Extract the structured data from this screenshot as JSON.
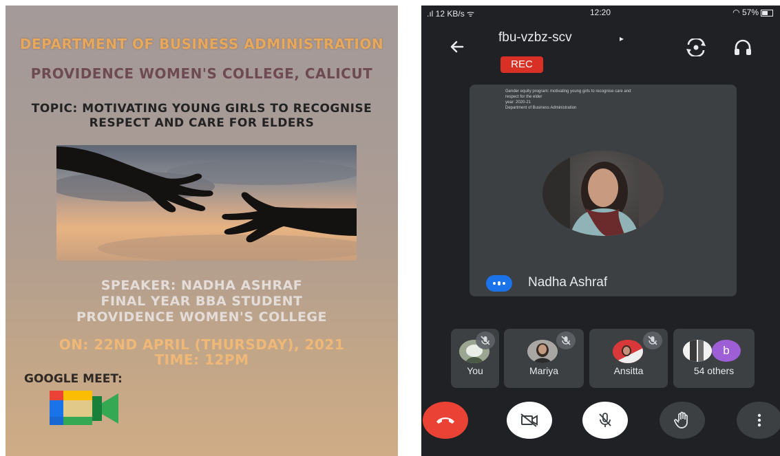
{
  "poster": {
    "department": "DEPARTMENT OF BUSINESS ADMINISTRATION",
    "college": "PROVIDENCE WOMEN'S COLLEGE, CALICUT",
    "topic_line1": "TOPIC: MOTIVATING YOUNG GIRLS TO RECOGNISE",
    "topic_line2": "RESPECT AND CARE FOR ELDERS",
    "speaker_line1": "SPEAKER: NADHA ASHRAF",
    "speaker_line2": "FINAL YEAR BBA STUDENT",
    "speaker_line3": "PROVIDENCE WOMEN'S COLLEGE",
    "date_line": "ON: 22ND APRIL (THURSDAY), 2021",
    "time_line": "TIME: 12PM",
    "platform": "GOOGLE MEET:",
    "logo_icon": "google-meet-logo"
  },
  "status_bar": {
    "network": ".ıl 12 KB/s ᯤ",
    "time": "12:20",
    "battery": "◠ 57%"
  },
  "meeting": {
    "code": "fbu-vzbz-scv",
    "caret": "▸",
    "rec_label": "REC",
    "back_icon": "arrow-back-icon",
    "flip_icon": "camera-flip-icon",
    "audio_icon": "headphones-icon"
  },
  "presenter": {
    "slide_line1": "Gender equity program: motivating young girls to recognise care and",
    "slide_line2": "respect for the elder",
    "slide_line3": "year: 2020-21",
    "slide_line4": "Department of Business Administration",
    "name": "Nadha Ashraf"
  },
  "participants": [
    {
      "label": "You",
      "muted": true
    },
    {
      "label": "Mariya",
      "muted": true
    },
    {
      "label": "Ansitta",
      "muted": true
    },
    {
      "label": "54 others",
      "initial": "b"
    }
  ],
  "controls": {
    "hangup_icon": "hang-up-icon",
    "camera_icon": "camera-off-icon",
    "mic_icon": "mic-off-icon",
    "hand_icon": "raise-hand-icon",
    "more_icon": "more-vert-icon"
  },
  "colors": {
    "rec": "#d93025",
    "hangup": "#ea4335",
    "speaking_badge": "#1a73e8",
    "others_avatar": "#9e5fd6",
    "app_background": "#202124"
  }
}
